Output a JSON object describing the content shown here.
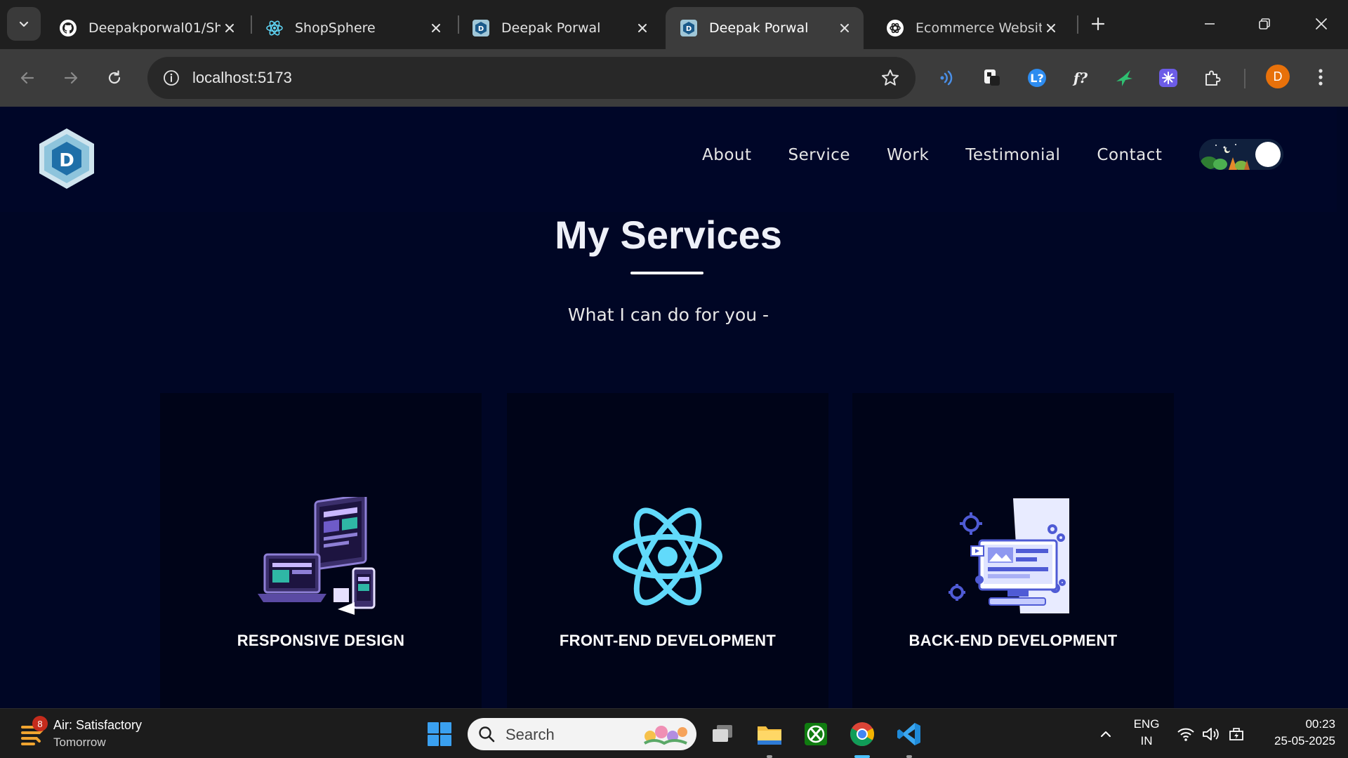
{
  "browser": {
    "tabs": [
      {
        "title": "Deepakporwal01/Sh",
        "favicon": "github-icon",
        "active": false
      },
      {
        "title": "ShopSphere",
        "favicon": "react-icon",
        "active": false
      },
      {
        "title": "Deepak Porwal",
        "favicon": "portfolio-logo-icon",
        "active": false
      },
      {
        "title": "Deepak Porwal",
        "favicon": "portfolio-logo-icon",
        "active": true
      },
      {
        "title": "Ecommerce Website",
        "favicon": "chatgpt-icon",
        "active": false
      }
    ],
    "url": "localhost:5173",
    "profile_initial": "D",
    "colors": {
      "profile": "#e8710a",
      "frame": "#1f1f1f",
      "toolbar": "#3c3c3c"
    }
  },
  "site": {
    "nav": {
      "links": [
        "About",
        "Service",
        "Work",
        "Testimonial",
        "Contact"
      ]
    },
    "theme_toggle": "dark",
    "services": {
      "title": "My Services",
      "subtitle": "What I can do for you -",
      "cards": [
        {
          "label": "RESPONSIVE DESIGN",
          "icon": "devices-icon"
        },
        {
          "label": "FRONT-END DEVELOPMENT",
          "icon": "react-atom-icon"
        },
        {
          "label": "BACK-END DEVELOPMENT",
          "icon": "backend-monitor-icon"
        }
      ]
    },
    "colors": {
      "background": "#000625",
      "card": "#000418",
      "accent": "#61dafb"
    }
  },
  "taskbar": {
    "weather": {
      "line1": "Air: Satisfactory",
      "line2": "Tomorrow",
      "badge": "8"
    },
    "search_placeholder": "Search",
    "language": {
      "line1": "ENG",
      "line2": "IN"
    },
    "time": "00:23",
    "date": "25-05-2025"
  }
}
